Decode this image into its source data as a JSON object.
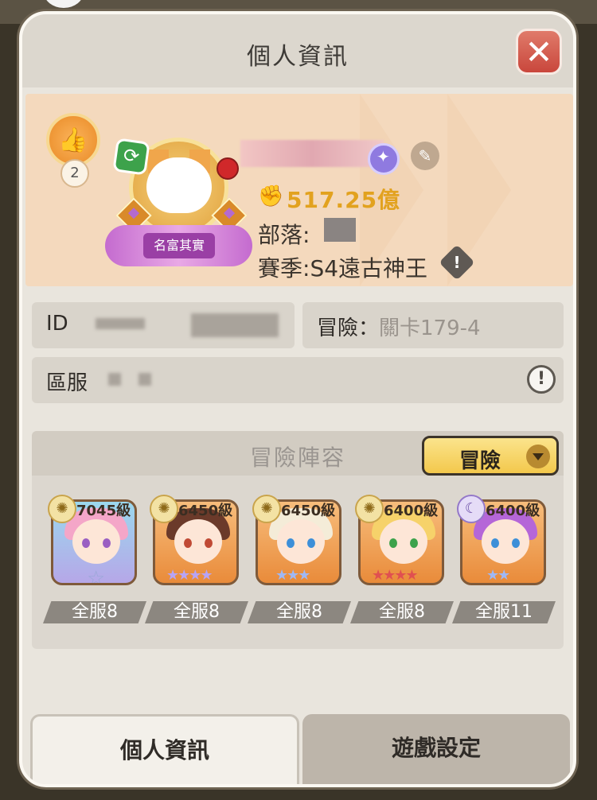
{
  "window": {
    "title": "個人資訊",
    "close_icon": "close-icon"
  },
  "profile": {
    "likes": "2",
    "avatar_banner": "名富其實",
    "power": "517.25億",
    "tribe_label": "部落:",
    "season_label": "賽季:",
    "season_value": "S4遠古神王"
  },
  "info": {
    "id_label": "ID",
    "adventure_label": "冒險：",
    "adventure_value": "關卡179-4",
    "server_label": "區服"
  },
  "lineup": {
    "title": "冒險陣容",
    "mode_label": "冒險",
    "heroes": [
      {
        "level": "7045級",
        "rank": "全服8",
        "stars": "☆",
        "star_color": "#9aa7d8",
        "badge_icon": "sun-icon"
      },
      {
        "level": "6450級",
        "rank": "全服8",
        "stars": "★★★★",
        "star_color": "#b7a4f5",
        "badge_icon": "sun-icon"
      },
      {
        "level": "6450級",
        "rank": "全服8",
        "stars": "★★★",
        "star_color": "#9fb8f5",
        "badge_icon": "sun-icon"
      },
      {
        "level": "6400級",
        "rank": "全服8",
        "stars": "★★★★",
        "star_color": "#e05050",
        "badge_icon": "sun-icon"
      },
      {
        "level": "6400級",
        "rank": "全服11",
        "stars": "★★",
        "star_color": "#9fb8f5",
        "badge_icon": "moon-icon"
      }
    ]
  },
  "tabs": {
    "active": "個人資訊",
    "inactive": "遊戲設定"
  }
}
